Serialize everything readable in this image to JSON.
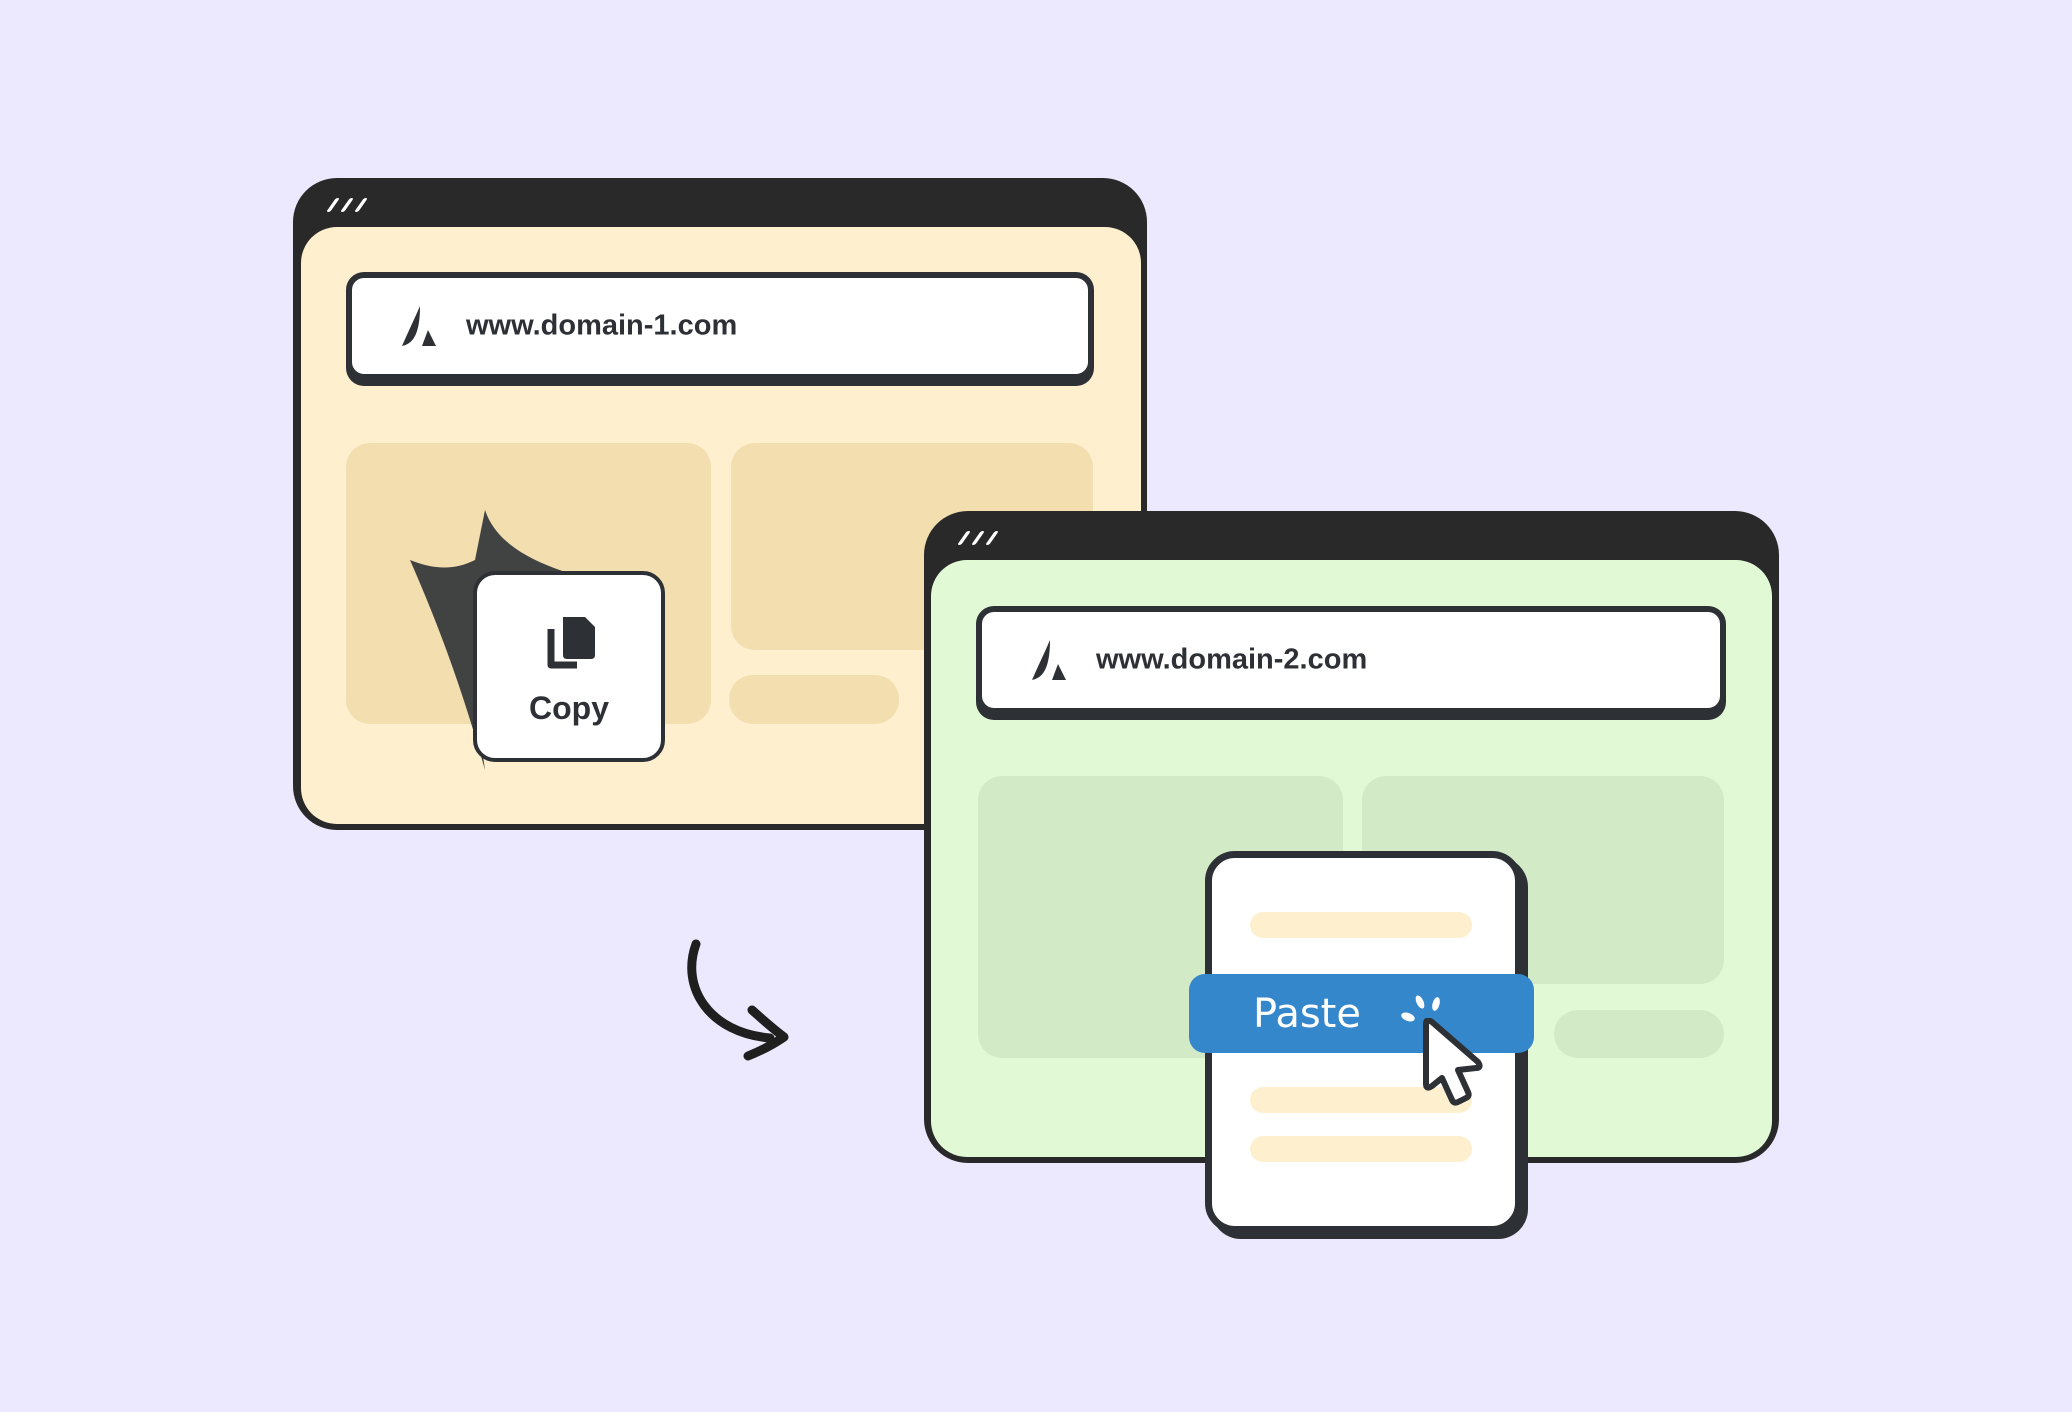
{
  "colors": {
    "background": "#ECE8FD",
    "window_frame": "#292929",
    "window1_bg": "#FEF0CF",
    "window1_block": "#F3DEB0",
    "window2_bg": "#E1FAD5",
    "window2_block": "#D3EAC7",
    "paste_accent": "#3587CB",
    "ink": "#2D3136"
  },
  "window1": {
    "url": "www.domain-1.com",
    "logo_icon": "triangle-logo-icon"
  },
  "copy_card": {
    "icon": "copy-icon",
    "label": "Copy"
  },
  "window2": {
    "url": "www.domain-2.com",
    "logo_icon": "triangle-logo-icon"
  },
  "paste_menu": {
    "label": "Paste",
    "cursor_icon": "pointer-cursor-icon"
  },
  "arrow_icon": "curved-arrow-icon"
}
